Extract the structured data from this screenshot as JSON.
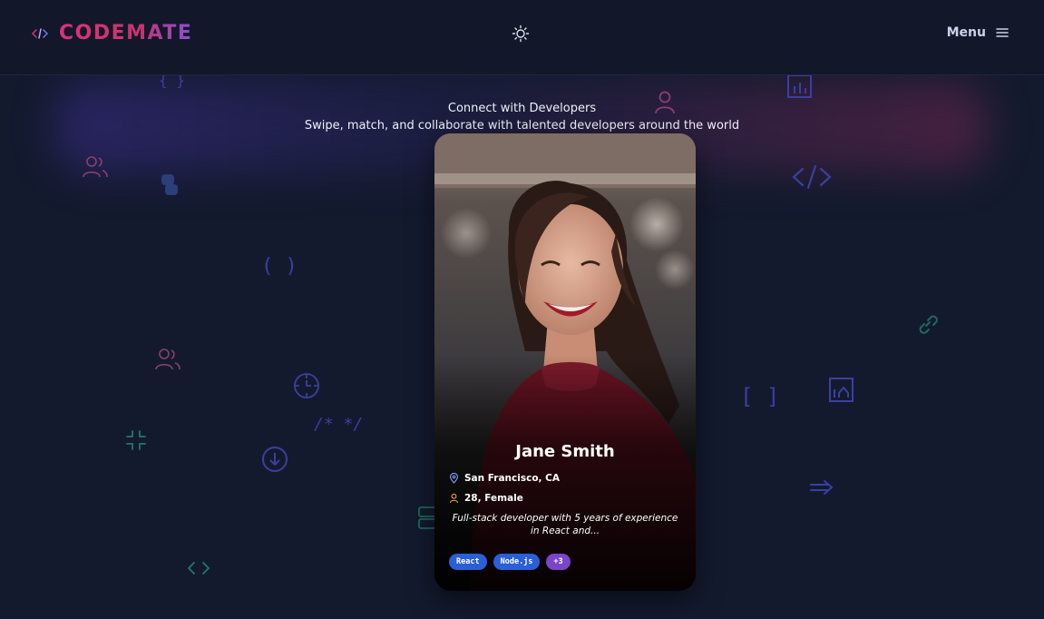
{
  "header": {
    "logo_text": "CODEMATE",
    "menu_label": "Menu"
  },
  "hero": {
    "title": "Connect with Developers",
    "subtitle": "Swipe, match, and collaborate with talented developers around the world"
  },
  "profile": {
    "name": "Jane Smith",
    "location": "San Francisco, CA",
    "age_gender": "28, Female",
    "bio": "Full-stack developer with 5 years of experience in React and...",
    "skills": [
      "React",
      "Node.js"
    ],
    "more_skills": "+3"
  },
  "colors": {
    "background": "#131a2e",
    "brand_pink": "#e0307a",
    "tag_blue": "#2a5fd6",
    "tag_purple": "#7a45c9"
  },
  "icons": {
    "logo": "code-broadcast-icon",
    "theme": "sun-icon",
    "menu": "hamburger-icon",
    "location": "map-pin-icon",
    "person": "user-icon"
  }
}
